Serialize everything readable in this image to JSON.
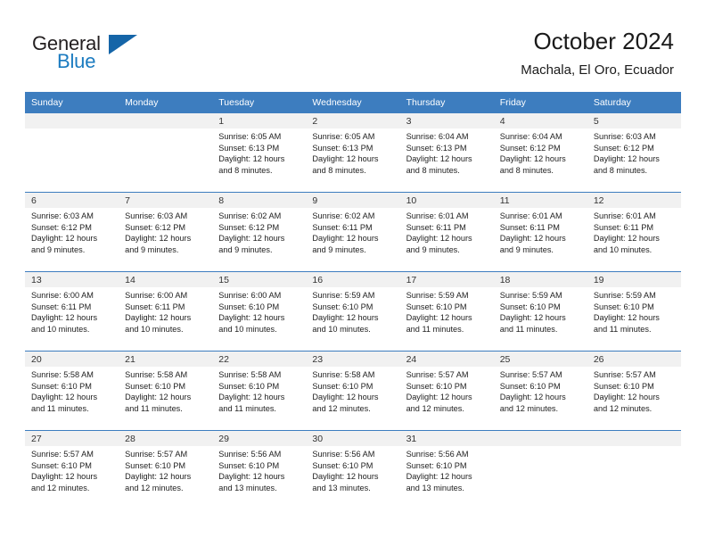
{
  "brand": {
    "name_part1": "General",
    "name_part2": "Blue",
    "triangle_icon": "triangle-icon"
  },
  "header": {
    "title": "October 2024",
    "subtitle": "Machala, El Oro, Ecuador"
  },
  "colors": {
    "header_blue": "#3d7dbf",
    "brand_blue": "#1b7bc0",
    "daynum_band": "#f1f1f1",
    "text": "#222222"
  },
  "weekday_headers": [
    "Sunday",
    "Monday",
    "Tuesday",
    "Wednesday",
    "Thursday",
    "Friday",
    "Saturday"
  ],
  "labels": {
    "sunrise_prefix": "Sunrise:",
    "sunset_prefix": "Sunset:",
    "daylight_prefix": "Daylight:"
  },
  "weeks": [
    [
      {
        "day": "",
        "sunrise": "",
        "sunset": "",
        "daylight": "",
        "daylight2": ""
      },
      {
        "day": "",
        "sunrise": "",
        "sunset": "",
        "daylight": "",
        "daylight2": ""
      },
      {
        "day": "1",
        "sunrise": "Sunrise: 6:05 AM",
        "sunset": "Sunset: 6:13 PM",
        "daylight": "Daylight: 12 hours",
        "daylight2": "and 8 minutes."
      },
      {
        "day": "2",
        "sunrise": "Sunrise: 6:05 AM",
        "sunset": "Sunset: 6:13 PM",
        "daylight": "Daylight: 12 hours",
        "daylight2": "and 8 minutes."
      },
      {
        "day": "3",
        "sunrise": "Sunrise: 6:04 AM",
        "sunset": "Sunset: 6:13 PM",
        "daylight": "Daylight: 12 hours",
        "daylight2": "and 8 minutes."
      },
      {
        "day": "4",
        "sunrise": "Sunrise: 6:04 AM",
        "sunset": "Sunset: 6:12 PM",
        "daylight": "Daylight: 12 hours",
        "daylight2": "and 8 minutes."
      },
      {
        "day": "5",
        "sunrise": "Sunrise: 6:03 AM",
        "sunset": "Sunset: 6:12 PM",
        "daylight": "Daylight: 12 hours",
        "daylight2": "and 8 minutes."
      }
    ],
    [
      {
        "day": "6",
        "sunrise": "Sunrise: 6:03 AM",
        "sunset": "Sunset: 6:12 PM",
        "daylight": "Daylight: 12 hours",
        "daylight2": "and 9 minutes."
      },
      {
        "day": "7",
        "sunrise": "Sunrise: 6:03 AM",
        "sunset": "Sunset: 6:12 PM",
        "daylight": "Daylight: 12 hours",
        "daylight2": "and 9 minutes."
      },
      {
        "day": "8",
        "sunrise": "Sunrise: 6:02 AM",
        "sunset": "Sunset: 6:12 PM",
        "daylight": "Daylight: 12 hours",
        "daylight2": "and 9 minutes."
      },
      {
        "day": "9",
        "sunrise": "Sunrise: 6:02 AM",
        "sunset": "Sunset: 6:11 PM",
        "daylight": "Daylight: 12 hours",
        "daylight2": "and 9 minutes."
      },
      {
        "day": "10",
        "sunrise": "Sunrise: 6:01 AM",
        "sunset": "Sunset: 6:11 PM",
        "daylight": "Daylight: 12 hours",
        "daylight2": "and 9 minutes."
      },
      {
        "day": "11",
        "sunrise": "Sunrise: 6:01 AM",
        "sunset": "Sunset: 6:11 PM",
        "daylight": "Daylight: 12 hours",
        "daylight2": "and 9 minutes."
      },
      {
        "day": "12",
        "sunrise": "Sunrise: 6:01 AM",
        "sunset": "Sunset: 6:11 PM",
        "daylight": "Daylight: 12 hours",
        "daylight2": "and 10 minutes."
      }
    ],
    [
      {
        "day": "13",
        "sunrise": "Sunrise: 6:00 AM",
        "sunset": "Sunset: 6:11 PM",
        "daylight": "Daylight: 12 hours",
        "daylight2": "and 10 minutes."
      },
      {
        "day": "14",
        "sunrise": "Sunrise: 6:00 AM",
        "sunset": "Sunset: 6:11 PM",
        "daylight": "Daylight: 12 hours",
        "daylight2": "and 10 minutes."
      },
      {
        "day": "15",
        "sunrise": "Sunrise: 6:00 AM",
        "sunset": "Sunset: 6:10 PM",
        "daylight": "Daylight: 12 hours",
        "daylight2": "and 10 minutes."
      },
      {
        "day": "16",
        "sunrise": "Sunrise: 5:59 AM",
        "sunset": "Sunset: 6:10 PM",
        "daylight": "Daylight: 12 hours",
        "daylight2": "and 10 minutes."
      },
      {
        "day": "17",
        "sunrise": "Sunrise: 5:59 AM",
        "sunset": "Sunset: 6:10 PM",
        "daylight": "Daylight: 12 hours",
        "daylight2": "and 11 minutes."
      },
      {
        "day": "18",
        "sunrise": "Sunrise: 5:59 AM",
        "sunset": "Sunset: 6:10 PM",
        "daylight": "Daylight: 12 hours",
        "daylight2": "and 11 minutes."
      },
      {
        "day": "19",
        "sunrise": "Sunrise: 5:59 AM",
        "sunset": "Sunset: 6:10 PM",
        "daylight": "Daylight: 12 hours",
        "daylight2": "and 11 minutes."
      }
    ],
    [
      {
        "day": "20",
        "sunrise": "Sunrise: 5:58 AM",
        "sunset": "Sunset: 6:10 PM",
        "daylight": "Daylight: 12 hours",
        "daylight2": "and 11 minutes."
      },
      {
        "day": "21",
        "sunrise": "Sunrise: 5:58 AM",
        "sunset": "Sunset: 6:10 PM",
        "daylight": "Daylight: 12 hours",
        "daylight2": "and 11 minutes."
      },
      {
        "day": "22",
        "sunrise": "Sunrise: 5:58 AM",
        "sunset": "Sunset: 6:10 PM",
        "daylight": "Daylight: 12 hours",
        "daylight2": "and 11 minutes."
      },
      {
        "day": "23",
        "sunrise": "Sunrise: 5:58 AM",
        "sunset": "Sunset: 6:10 PM",
        "daylight": "Daylight: 12 hours",
        "daylight2": "and 12 minutes."
      },
      {
        "day": "24",
        "sunrise": "Sunrise: 5:57 AM",
        "sunset": "Sunset: 6:10 PM",
        "daylight": "Daylight: 12 hours",
        "daylight2": "and 12 minutes."
      },
      {
        "day": "25",
        "sunrise": "Sunrise: 5:57 AM",
        "sunset": "Sunset: 6:10 PM",
        "daylight": "Daylight: 12 hours",
        "daylight2": "and 12 minutes."
      },
      {
        "day": "26",
        "sunrise": "Sunrise: 5:57 AM",
        "sunset": "Sunset: 6:10 PM",
        "daylight": "Daylight: 12 hours",
        "daylight2": "and 12 minutes."
      }
    ],
    [
      {
        "day": "27",
        "sunrise": "Sunrise: 5:57 AM",
        "sunset": "Sunset: 6:10 PM",
        "daylight": "Daylight: 12 hours",
        "daylight2": "and 12 minutes."
      },
      {
        "day": "28",
        "sunrise": "Sunrise: 5:57 AM",
        "sunset": "Sunset: 6:10 PM",
        "daylight": "Daylight: 12 hours",
        "daylight2": "and 12 minutes."
      },
      {
        "day": "29",
        "sunrise": "Sunrise: 5:56 AM",
        "sunset": "Sunset: 6:10 PM",
        "daylight": "Daylight: 12 hours",
        "daylight2": "and 13 minutes."
      },
      {
        "day": "30",
        "sunrise": "Sunrise: 5:56 AM",
        "sunset": "Sunset: 6:10 PM",
        "daylight": "Daylight: 12 hours",
        "daylight2": "and 13 minutes."
      },
      {
        "day": "31",
        "sunrise": "Sunrise: 5:56 AM",
        "sunset": "Sunset: 6:10 PM",
        "daylight": "Daylight: 12 hours",
        "daylight2": "and 13 minutes."
      },
      {
        "day": "",
        "sunrise": "",
        "sunset": "",
        "daylight": "",
        "daylight2": ""
      },
      {
        "day": "",
        "sunrise": "",
        "sunset": "",
        "daylight": "",
        "daylight2": ""
      }
    ]
  ]
}
